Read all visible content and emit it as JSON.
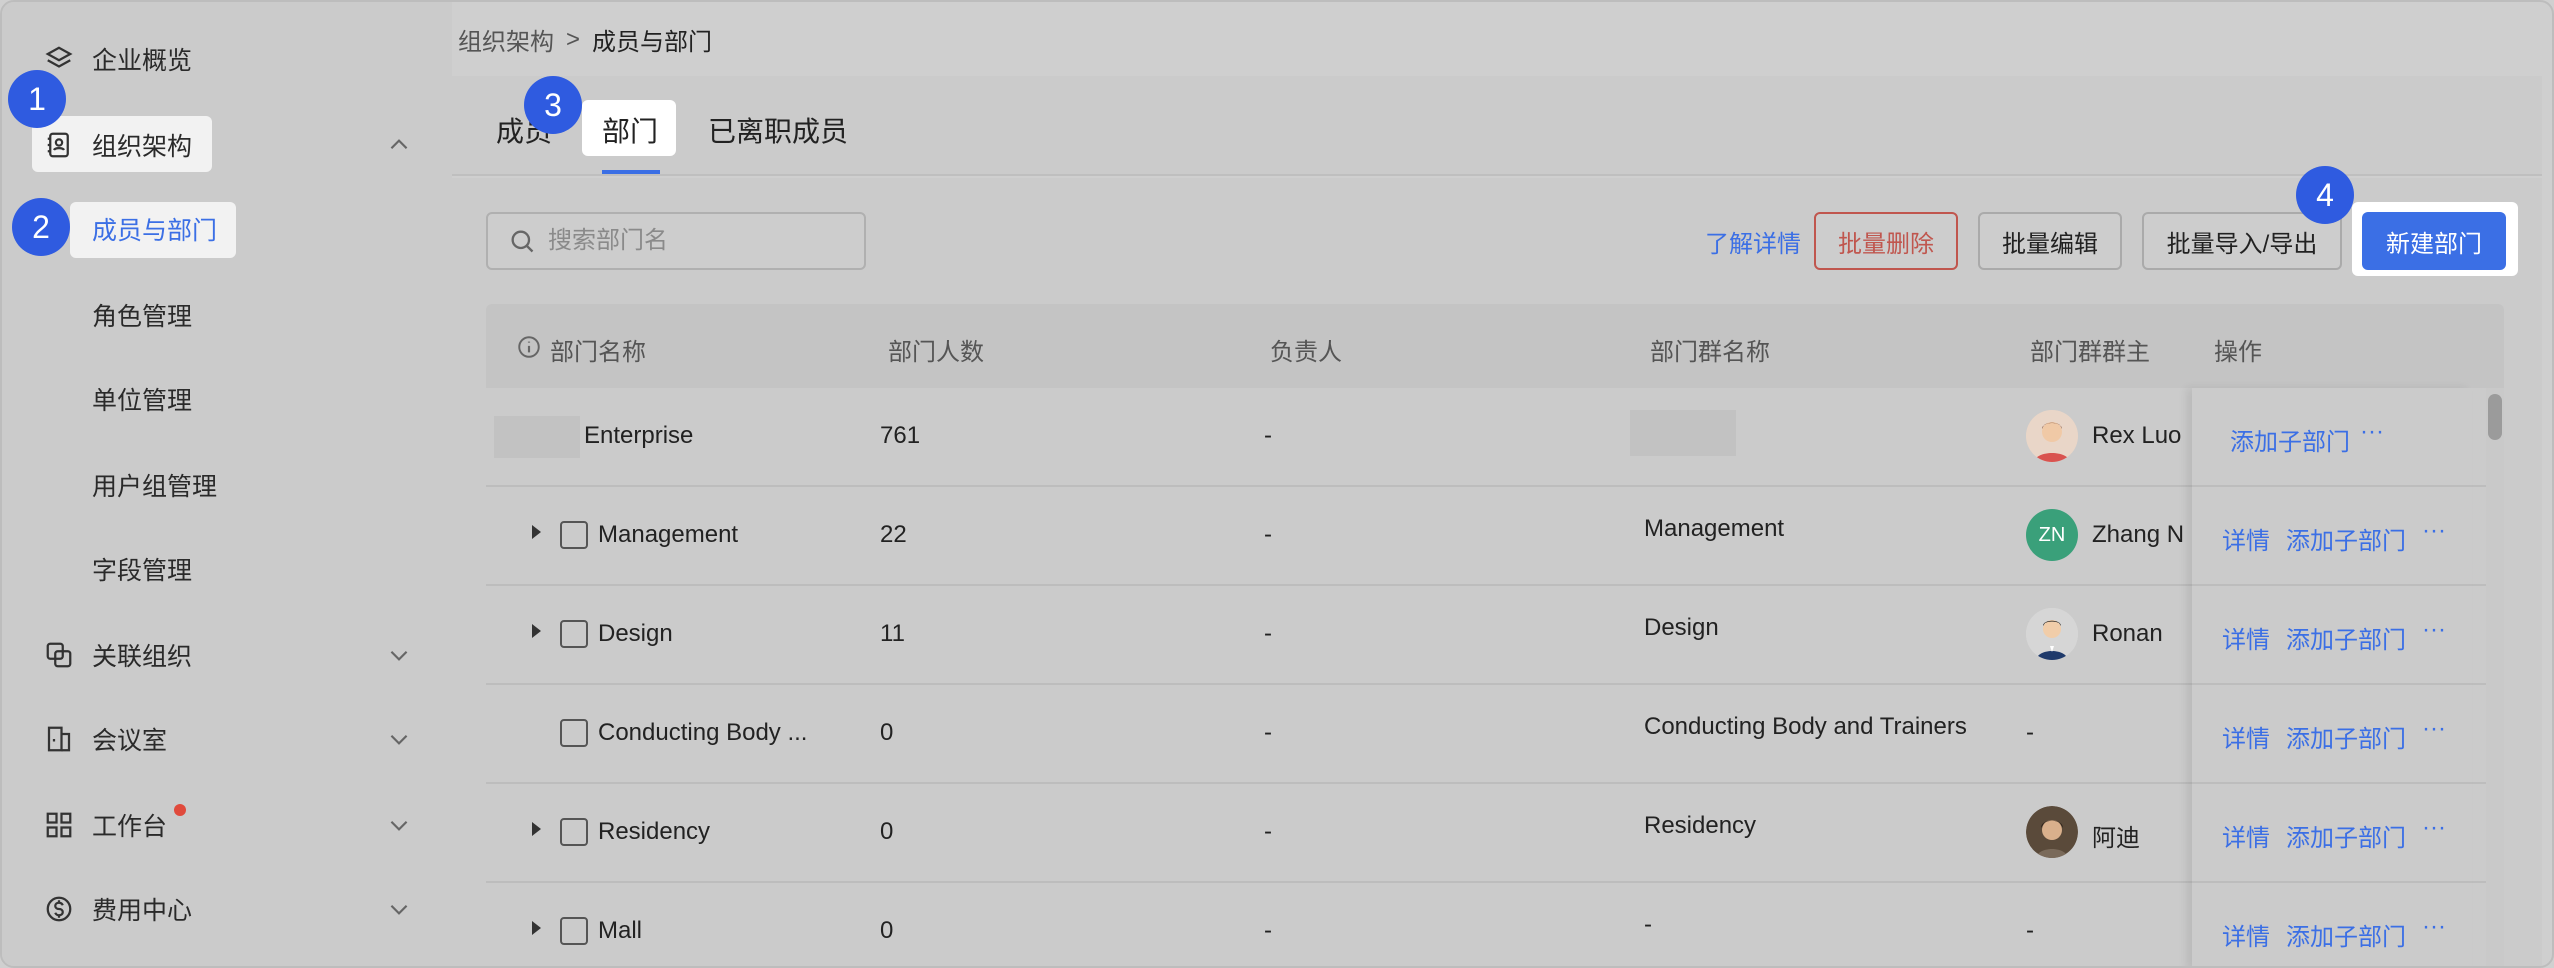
{
  "colors": {
    "accent": "#3b6fe5",
    "danger": "#c0564e",
    "step_badge": "#2f5be0",
    "notify_dot": "#e04a3c"
  },
  "sidebar": {
    "items": [
      {
        "label": "企业概览",
        "icon": "layers-icon"
      },
      {
        "label": "组织架构",
        "icon": "contact-book-icon",
        "expanded": true
      },
      {
        "label": "成员与部门",
        "active": true
      },
      {
        "label": "角色管理"
      },
      {
        "label": "单位管理"
      },
      {
        "label": "用户组管理"
      },
      {
        "label": "字段管理"
      },
      {
        "label": "关联组织",
        "icon": "linked-org-icon"
      },
      {
        "label": "会议室",
        "icon": "meeting-room-icon"
      },
      {
        "label": "工作台",
        "icon": "grid-icon",
        "has_dot": true
      },
      {
        "label": "费用中心",
        "icon": "dollar-icon"
      }
    ]
  },
  "steps": [
    "1",
    "2",
    "3",
    "4"
  ],
  "breadcrumb": {
    "parent": "组织架构",
    "separator": ">",
    "current": "成员与部门"
  },
  "tabs": [
    {
      "label": "成员"
    },
    {
      "label": "部门",
      "active": true
    },
    {
      "label": "已离职成员"
    }
  ],
  "toolbar": {
    "search_placeholder": "搜索部门名",
    "learn_more": "了解详情",
    "batch_delete": "批量删除",
    "batch_edit": "批量编辑",
    "batch_import_export": "批量导入/导出",
    "new_department": "新建部门"
  },
  "table": {
    "headers": [
      "部门名称",
      "部门人数",
      "负责人",
      "部门群名称",
      "部门群群主",
      "操作"
    ],
    "rows": [
      {
        "name": "Enterprise",
        "count": "761",
        "leader": "-",
        "group": "",
        "owner": "Rex Luo",
        "ops": [
          "添加子部门",
          "···"
        ]
      },
      {
        "name": "Management",
        "count": "22",
        "leader": "-",
        "group": "Management",
        "owner": "Zhang N",
        "owner_initials": "ZN",
        "ops": [
          "详情",
          "添加子部门",
          "···"
        ]
      },
      {
        "name": "Design",
        "count": "11",
        "leader": "-",
        "group": "Design",
        "owner": "Ronan",
        "ops": [
          "详情",
          "添加子部门",
          "···"
        ]
      },
      {
        "name": "Conducting Body ...",
        "count": "0",
        "leader": "-",
        "group": "Conducting Body and Trainers",
        "owner": "-",
        "ops": [
          "详情",
          "添加子部门",
          "···"
        ]
      },
      {
        "name": "Residency",
        "count": "0",
        "leader": "-",
        "group": "Residency",
        "owner": "阿迪",
        "ops": [
          "详情",
          "添加子部门",
          "···"
        ]
      },
      {
        "name": "Mall",
        "count": "0",
        "leader": "-",
        "group": "-",
        "owner": "-",
        "ops": [
          "详情",
          "添加子部门",
          "···"
        ]
      }
    ]
  }
}
